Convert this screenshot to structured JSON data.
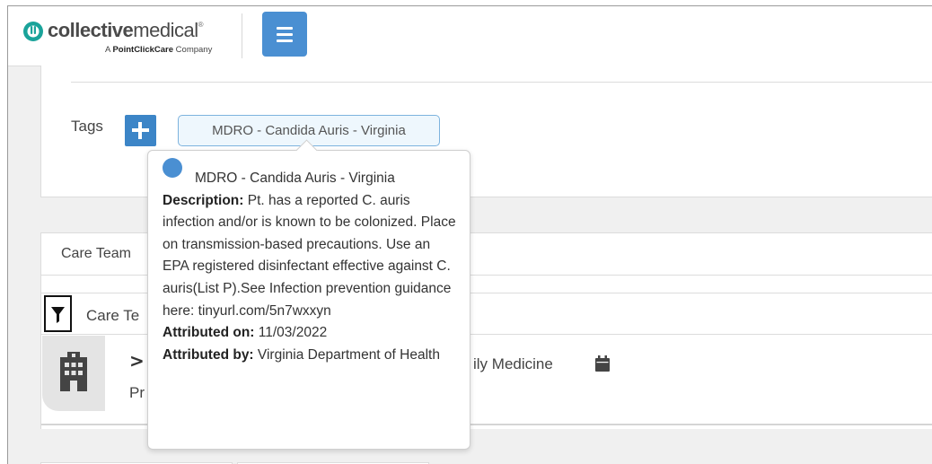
{
  "header": {
    "logo_word_bold": "collective",
    "logo_word_light": "medical",
    "logo_registered": "®",
    "logo_tagline_prefix": "A ",
    "logo_tagline_brand": "PointClickCare",
    "logo_tagline_suffix": " Company",
    "menu_icon": "hamburger-icon"
  },
  "tags": {
    "label": "Tags",
    "add_icon": "plus-icon",
    "chip_label": "MDRO - Candida Auris - Virginia"
  },
  "care_team": {
    "tab_label": "Care Team",
    "section_label": "Care Te",
    "filter_icon": "filter-icon",
    "row_icon": "building-icon",
    "row_chevron": ">",
    "row_text_prefix": "Pr",
    "row_specialty": "ily Medicine",
    "calendar_icon": "calendar-icon"
  },
  "popover": {
    "title": "MDRO - Candida Auris - Virginia",
    "description_label": "Description:",
    "description_text": " Pt. has a reported C. auris infection and/or is known to be colonized. Place on transmission-based precautions. Use an EPA registered disinfectant effective against C. auris(List P).See Infection prevention guidance here: tinyurl.com/5n7wxxyn",
    "attributed_on_label": "Attributed on:",
    "attributed_on_value": " 11/03/2022",
    "attributed_by_label": "Attributed by:",
    "attributed_by_value": " Virginia Department of Health",
    "dot_color": "#4a8fd2"
  },
  "colors": {
    "brand_blue": "#4a8fd2",
    "button_blue": "#3c85c7",
    "chip_border": "#7db3de"
  }
}
